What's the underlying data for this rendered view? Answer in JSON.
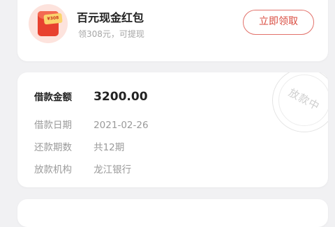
{
  "promo": {
    "title": "百元现金红包",
    "subtitle": "领308元，可提现",
    "coupon_text": "¥308",
    "button_label": "立即领取",
    "icon": "red-envelope-icon"
  },
  "loan": {
    "rows": [
      {
        "label": "借款金额",
        "value": "3200.00"
      },
      {
        "label": "借款日期",
        "value": "2021-02-26"
      },
      {
        "label": "还款期数",
        "value": "共12期"
      },
      {
        "label": "放款机构",
        "value": "龙江银行"
      }
    ],
    "stamp": "放款中"
  },
  "colors": {
    "accent": "#e2716a",
    "background": "#f1f1f3",
    "envelope": "#e8412f"
  }
}
